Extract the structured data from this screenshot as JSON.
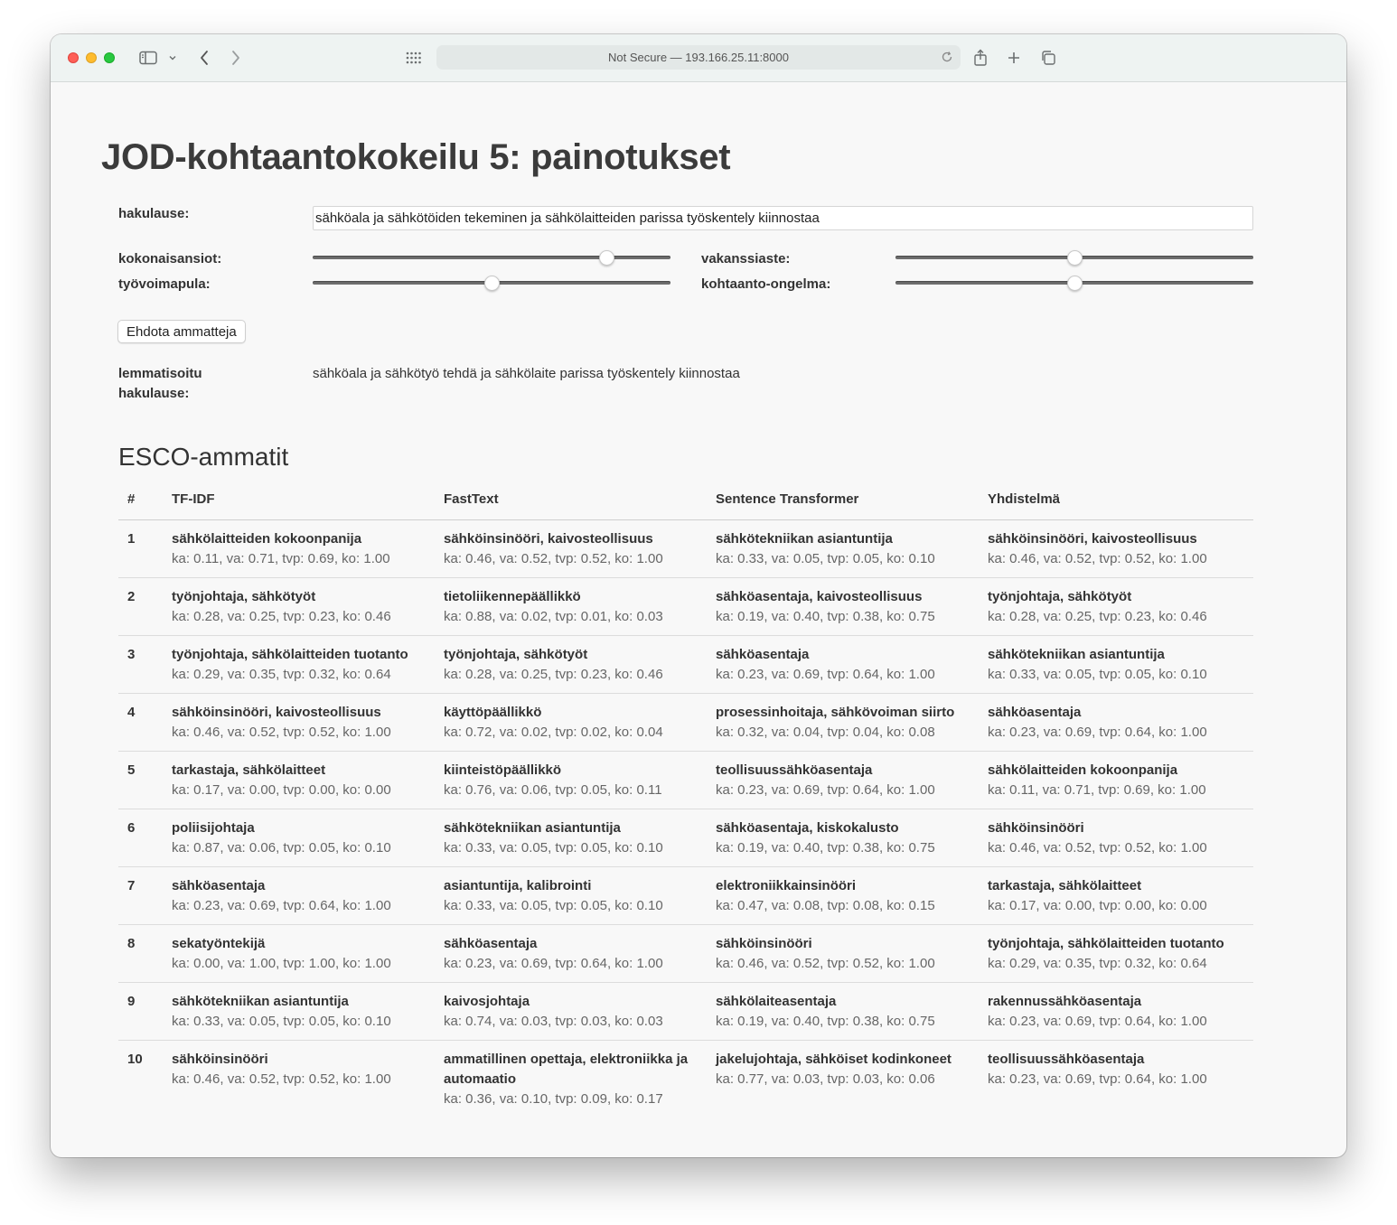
{
  "browser": {
    "url": "Not Secure — 193.166.25.11:8000"
  },
  "page": {
    "title": "JOD-kohtaantokokeilu 5: painotukset",
    "query_label": "hakulause:",
    "query_value": "sähköala ja sähkötöiden tekeminen ja sähkölaitteiden parissa työskentely kiinnostaa",
    "sliders": [
      {
        "label": "kokonaisansiot:",
        "value": 0.82
      },
      {
        "label": "vakanssiaste:",
        "value": 0.5
      },
      {
        "label": "työvoimapula:",
        "value": 0.5
      },
      {
        "label": "kohtaanto-ongelma:",
        "value": 0.5
      }
    ],
    "suggest_button": "Ehdota ammatteja",
    "lemma_label_1": "lemmatisoitu",
    "lemma_label_2": "hakulause:",
    "lemma_value": "sähköala ja sähkötyö tehdä ja sähkölaite parissa työskentely kiinnostaa",
    "section_title": "ESCO-ammatit"
  },
  "table": {
    "headers": [
      "#",
      "TF-IDF",
      "FastText",
      "Sentence Transformer",
      "Yhdistelmä"
    ],
    "rows": [
      {
        "n": "1",
        "a": {
          "name": "sähkölaitteiden kokoonpanija",
          "scores": "ka: 0.11, va: 0.71, tvp: 0.69, ko: 1.00"
        },
        "b": {
          "name": "sähköinsinööri, kaivosteollisuus",
          "scores": "ka: 0.46, va: 0.52, tvp: 0.52, ko: 1.00"
        },
        "c": {
          "name": "sähkötekniikan asiantuntija",
          "scores": "ka: 0.33, va: 0.05, tvp: 0.05, ko: 0.10"
        },
        "d": {
          "name": "sähköinsinööri, kaivosteollisuus",
          "scores": "ka: 0.46, va: 0.52, tvp: 0.52, ko: 1.00"
        }
      },
      {
        "n": "2",
        "a": {
          "name": "työnjohtaja, sähkötyöt",
          "scores": "ka: 0.28, va: 0.25, tvp: 0.23, ko: 0.46"
        },
        "b": {
          "name": "tietoliikennepäällikkö",
          "scores": "ka: 0.88, va: 0.02, tvp: 0.01, ko: 0.03"
        },
        "c": {
          "name": "sähköasentaja, kaivosteollisuus",
          "scores": "ka: 0.19, va: 0.40, tvp: 0.38, ko: 0.75"
        },
        "d": {
          "name": "työnjohtaja, sähkötyöt",
          "scores": "ka: 0.28, va: 0.25, tvp: 0.23, ko: 0.46"
        }
      },
      {
        "n": "3",
        "a": {
          "name": "työnjohtaja, sähkölaitteiden tuotanto",
          "scores": "ka: 0.29, va: 0.35, tvp: 0.32, ko: 0.64"
        },
        "b": {
          "name": "työnjohtaja, sähkötyöt",
          "scores": "ka: 0.28, va: 0.25, tvp: 0.23, ko: 0.46"
        },
        "c": {
          "name": "sähköasentaja",
          "scores": "ka: 0.23, va: 0.69, tvp: 0.64, ko: 1.00"
        },
        "d": {
          "name": "sähkötekniikan asiantuntija",
          "scores": "ka: 0.33, va: 0.05, tvp: 0.05, ko: 0.10"
        }
      },
      {
        "n": "4",
        "a": {
          "name": "sähköinsinööri, kaivosteollisuus",
          "scores": "ka: 0.46, va: 0.52, tvp: 0.52, ko: 1.00"
        },
        "b": {
          "name": "käyttöpäällikkö",
          "scores": "ka: 0.72, va: 0.02, tvp: 0.02, ko: 0.04"
        },
        "c": {
          "name": "prosessinhoitaja, sähkövoiman siirto",
          "scores": "ka: 0.32, va: 0.04, tvp: 0.04, ko: 0.08"
        },
        "d": {
          "name": "sähköasentaja",
          "scores": "ka: 0.23, va: 0.69, tvp: 0.64, ko: 1.00"
        }
      },
      {
        "n": "5",
        "a": {
          "name": "tarkastaja, sähkölaitteet",
          "scores": "ka: 0.17, va: 0.00, tvp: 0.00, ko: 0.00"
        },
        "b": {
          "name": "kiinteistöpäällikkö",
          "scores": "ka: 0.76, va: 0.06, tvp: 0.05, ko: 0.11"
        },
        "c": {
          "name": "teollisuussähköasentaja",
          "scores": "ka: 0.23, va: 0.69, tvp: 0.64, ko: 1.00"
        },
        "d": {
          "name": "sähkölaitteiden kokoonpanija",
          "scores": "ka: 0.11, va: 0.71, tvp: 0.69, ko: 1.00"
        }
      },
      {
        "n": "6",
        "a": {
          "name": "poliisijohtaja",
          "scores": "ka: 0.87, va: 0.06, tvp: 0.05, ko: 0.10"
        },
        "b": {
          "name": "sähkötekniikan asiantuntija",
          "scores": "ka: 0.33, va: 0.05, tvp: 0.05, ko: 0.10"
        },
        "c": {
          "name": "sähköasentaja, kiskokalusto",
          "scores": "ka: 0.19, va: 0.40, tvp: 0.38, ko: 0.75"
        },
        "d": {
          "name": "sähköinsinööri",
          "scores": "ka: 0.46, va: 0.52, tvp: 0.52, ko: 1.00"
        }
      },
      {
        "n": "7",
        "a": {
          "name": "sähköasentaja",
          "scores": "ka: 0.23, va: 0.69, tvp: 0.64, ko: 1.00"
        },
        "b": {
          "name": "asiantuntija, kalibrointi",
          "scores": "ka: 0.33, va: 0.05, tvp: 0.05, ko: 0.10"
        },
        "c": {
          "name": "elektroniikkainsinööri",
          "scores": "ka: 0.47, va: 0.08, tvp: 0.08, ko: 0.15"
        },
        "d": {
          "name": "tarkastaja, sähkölaitteet",
          "scores": "ka: 0.17, va: 0.00, tvp: 0.00, ko: 0.00"
        }
      },
      {
        "n": "8",
        "a": {
          "name": "sekatyöntekijä",
          "scores": "ka: 0.00, va: 1.00, tvp: 1.00, ko: 1.00"
        },
        "b": {
          "name": "sähköasentaja",
          "scores": "ka: 0.23, va: 0.69, tvp: 0.64, ko: 1.00"
        },
        "c": {
          "name": "sähköinsinööri",
          "scores": "ka: 0.46, va: 0.52, tvp: 0.52, ko: 1.00"
        },
        "d": {
          "name": "työnjohtaja, sähkölaitteiden tuotanto",
          "scores": "ka: 0.29, va: 0.35, tvp: 0.32, ko: 0.64"
        }
      },
      {
        "n": "9",
        "a": {
          "name": "sähkötekniikan asiantuntija",
          "scores": "ka: 0.33, va: 0.05, tvp: 0.05, ko: 0.10"
        },
        "b": {
          "name": "kaivosjohtaja",
          "scores": "ka: 0.74, va: 0.03, tvp: 0.03, ko: 0.03"
        },
        "c": {
          "name": "sähkölaiteasentaja",
          "scores": "ka: 0.19, va: 0.40, tvp: 0.38, ko: 0.75"
        },
        "d": {
          "name": "rakennussähköasentaja",
          "scores": "ka: 0.23, va: 0.69, tvp: 0.64, ko: 1.00"
        }
      },
      {
        "n": "10",
        "a": {
          "name": "sähköinsinööri",
          "scores": "ka: 0.46, va: 0.52, tvp: 0.52, ko: 1.00"
        },
        "b": {
          "name": "ammatillinen opettaja, elektroniikka ja automaatio",
          "scores": "ka: 0.36, va: 0.10, tvp: 0.09, ko: 0.17"
        },
        "c": {
          "name": "jakelujohtaja, sähköiset kodinkoneet",
          "scores": "ka: 0.77, va: 0.03, tvp: 0.03, ko: 0.06"
        },
        "d": {
          "name": "teollisuussähköasentaja",
          "scores": "ka: 0.23, va: 0.69, tvp: 0.64, ko: 1.00"
        }
      }
    ]
  }
}
